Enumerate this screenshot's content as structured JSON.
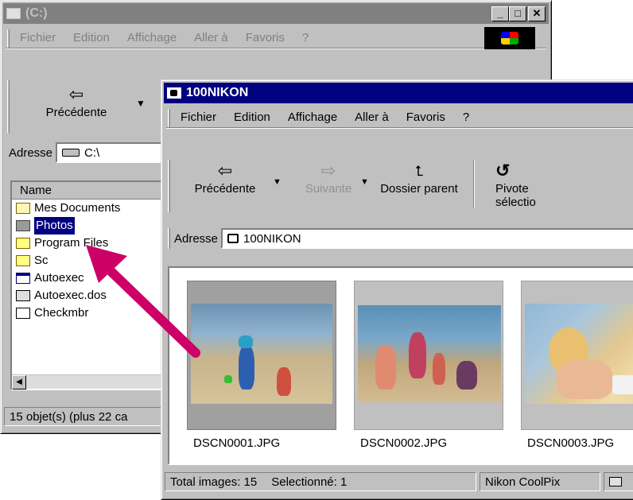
{
  "back_window": {
    "title": "(C:)",
    "menu": [
      "Fichier",
      "Edition",
      "Affichage",
      "Aller à",
      "Favoris",
      "?"
    ],
    "back_label": "Précédente",
    "address_label": "Adresse",
    "address_value": "C:\\",
    "column_name": "Name",
    "items": [
      {
        "label": "Mes Documents",
        "icon": "documents-folder-icon"
      },
      {
        "label": "Photos",
        "icon": "folder-icon",
        "selected": true
      },
      {
        "label": "Program Files",
        "icon": "folder-icon"
      },
      {
        "label": "Sc",
        "icon": "folder-icon"
      },
      {
        "label": "Autoexec",
        "icon": "app-icon"
      },
      {
        "label": "Autoexec.dos",
        "icon": "dos-file-icon"
      },
      {
        "label": "Checkmbr",
        "icon": "file-icon"
      }
    ],
    "status": "15 objet(s) (plus 22 ca"
  },
  "front_window": {
    "title": "100NIKON",
    "menu": [
      "Fichier",
      "Edition",
      "Affichage",
      "Aller à",
      "Favoris",
      "?"
    ],
    "toolbar": {
      "back": "Précédente",
      "forward": "Suivante",
      "parent": "Dossier parent",
      "rotate": "Pivote sélectio"
    },
    "address_label": "Adresse",
    "address_value": "100NIKON",
    "thumbnails": [
      {
        "caption": "DSCN0001.JPG",
        "selected": true
      },
      {
        "caption": "DSCN0002.JPG",
        "selected": false
      },
      {
        "caption": "DSCN0003.JPG",
        "selected": false
      }
    ],
    "status": {
      "total": "Total images: 15",
      "selected": "Selectionné: 1",
      "camera": "Nikon CoolPix"
    }
  },
  "colors": {
    "title_active": "#000080",
    "title_inactive": "#808080",
    "arrow": "#cc0066"
  }
}
